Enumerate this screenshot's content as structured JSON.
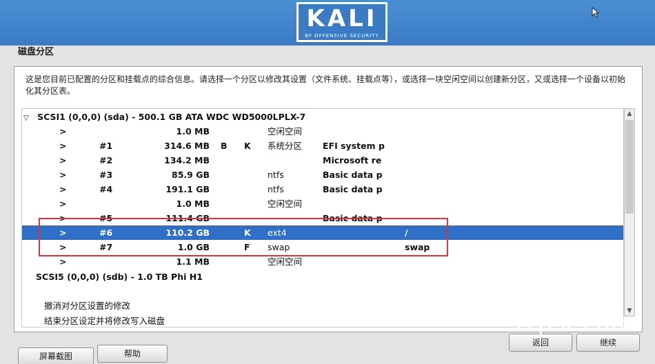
{
  "header": {
    "logo_text": "KALI",
    "logo_subtitle": "BY OFFENSIVE SECURITY"
  },
  "page_title": "磁盘分区",
  "info_text": "这是您目前已配置的分区和挂载点的综合信息。请选择一个分区以修改其设置（文件系统、挂载点等），或选择一块空闲空间以创建新分区，又或选择一个设备以初始化其分区表。",
  "devices": [
    {
      "label": "SCSI1 (0,0,0) (sda) - 500.1 GB ATA WDC WD5000LPLX-7",
      "expander": "▽"
    },
    {
      "label": "SCSI5 (0,0,0) (sdb) - 1.0 TB Phi H1"
    }
  ],
  "partitions": [
    {
      "arrow": ">",
      "num": "",
      "size": "1.0 MB",
      "flag_b": "",
      "flag_k": "",
      "fs": "空闲空间",
      "name": "",
      "mount": "",
      "selected": false
    },
    {
      "arrow": ">",
      "num": "#1",
      "size": "314.6 MB",
      "flag_b": "B",
      "flag_k": "K",
      "fs": "系统分区",
      "name": "EFI system p",
      "mount": "",
      "selected": false
    },
    {
      "arrow": ">",
      "num": "#2",
      "size": "134.2 MB",
      "flag_b": "",
      "flag_k": "",
      "fs": "",
      "name": "Microsoft re",
      "mount": "",
      "selected": false
    },
    {
      "arrow": ">",
      "num": "#3",
      "size": "85.9 GB",
      "flag_b": "",
      "flag_k": "",
      "fs": "ntfs",
      "name": "Basic data p",
      "mount": "",
      "selected": false
    },
    {
      "arrow": ">",
      "num": "#4",
      "size": "191.1 GB",
      "flag_b": "",
      "flag_k": "",
      "fs": "ntfs",
      "name": "Basic data p",
      "mount": "",
      "selected": false
    },
    {
      "arrow": ">",
      "num": "",
      "size": "1.0 MB",
      "flag_b": "",
      "flag_k": "",
      "fs": "空闲空间",
      "name": "",
      "mount": "",
      "selected": false
    },
    {
      "arrow": ">",
      "num": "#5",
      "size": "111.4 GB",
      "flag_b": "",
      "flag_k": "",
      "fs": "",
      "name": "Basic data p",
      "mount": "",
      "selected": false
    },
    {
      "arrow": ">",
      "num": "#6",
      "size": "110.2 GB",
      "flag_b": "",
      "flag_k": "K",
      "fs": "ext4",
      "name": "",
      "mount": "/",
      "selected": true
    },
    {
      "arrow": ">",
      "num": "#7",
      "size": "1.0 GB",
      "flag_b": "",
      "flag_k": "F",
      "fs": "swap",
      "name": "",
      "mount": "swap",
      "selected": false
    },
    {
      "arrow": ">",
      "num": "",
      "size": "1.1 MB",
      "flag_b": "",
      "flag_k": "",
      "fs": "空闲空间",
      "name": "",
      "mount": "",
      "selected": false
    }
  ],
  "actions": [
    "撤消对分区设置的修改",
    "结束分区设定并将修改写入磁盘"
  ],
  "buttons": {
    "screenshot": "屏幕截图",
    "help": "帮助",
    "back": "返回",
    "continue": "继续"
  },
  "watermark": "ivpsr.com",
  "colors": {
    "banner": "#3a7bc4",
    "selection": "#2f6fc8",
    "annotation": "#d9343b"
  }
}
